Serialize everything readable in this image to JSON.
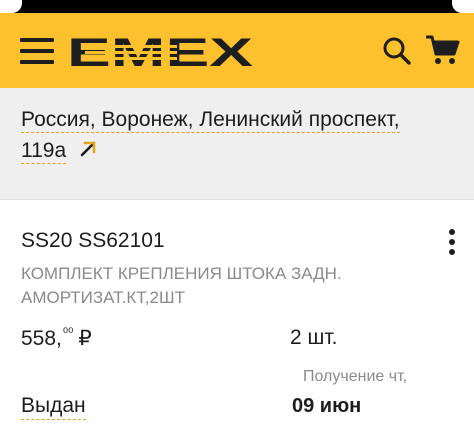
{
  "header": {
    "logo_text": "EMEX",
    "colors": {
      "brand": "#fcc12d",
      "ink": "#1e1e1e",
      "accent_underline": "#e3a51d"
    },
    "icons": [
      "menu-icon",
      "search-icon",
      "cart-icon"
    ]
  },
  "delivery": {
    "address_line1": "Россия, Воронеж, Ленинский проспект,",
    "address_line2": "119а",
    "link_icon": "arrow-up-right-icon"
  },
  "order_item": {
    "code": "SS20 SS62101",
    "description": "КОМПЛЕКТ КРЕПЛЕНИЯ ШТОКА ЗАДН. АМОРТИЗАТ.КТ,2ШТ",
    "price_main": "558,",
    "price_fraction": "⁰⁰",
    "currency": "₽",
    "quantity": "2 шт.",
    "status": "Выдан",
    "receive_label": "Получение чт,",
    "receive_date": "09 июн",
    "menu_icon": "more-vertical-icon"
  }
}
